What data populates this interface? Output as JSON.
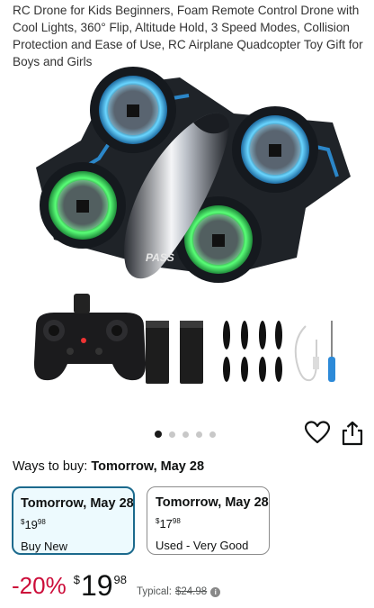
{
  "product": {
    "title": "RC Drone for Kids Beginners, Foam Remote Control Drone with Cool Lights, 360° Flip, Altitude Hold, 3 Speed Modes, Collision Protection and Ease of Use, RC Airplane Quadcopter Toy Gift for Boys and Girls",
    "drone_label": "PASS"
  },
  "gallery": {
    "dot_count": 5,
    "active_index": 0
  },
  "actions": {
    "heart_icon": "heart-icon",
    "share_icon": "share-icon"
  },
  "ways_to_buy": {
    "label": "Ways to buy:",
    "value": "Tomorrow, May 28"
  },
  "options": [
    {
      "delivery": "Tomorrow, May 28",
      "price_symbol": "$",
      "price_whole": "19",
      "price_fraction": "98",
      "condition": "Buy New",
      "selected": true
    },
    {
      "delivery": "Tomorrow, May 28",
      "price_symbol": "$",
      "price_whole": "17",
      "price_fraction": "98",
      "condition": "Used - Very Good",
      "selected": false
    }
  ],
  "price": {
    "discount": "-20%",
    "symbol": "$",
    "whole": "19",
    "fraction": "98",
    "typical_label": "Typical:",
    "typical_price": "$24.98"
  },
  "colors": {
    "accent_blue": "#1c6a8d",
    "discount_red": "#cc0c39",
    "selected_bg": "#edfafe",
    "drone_blue_glow": "#4fc3ff",
    "drone_green_glow": "#39e65a"
  }
}
